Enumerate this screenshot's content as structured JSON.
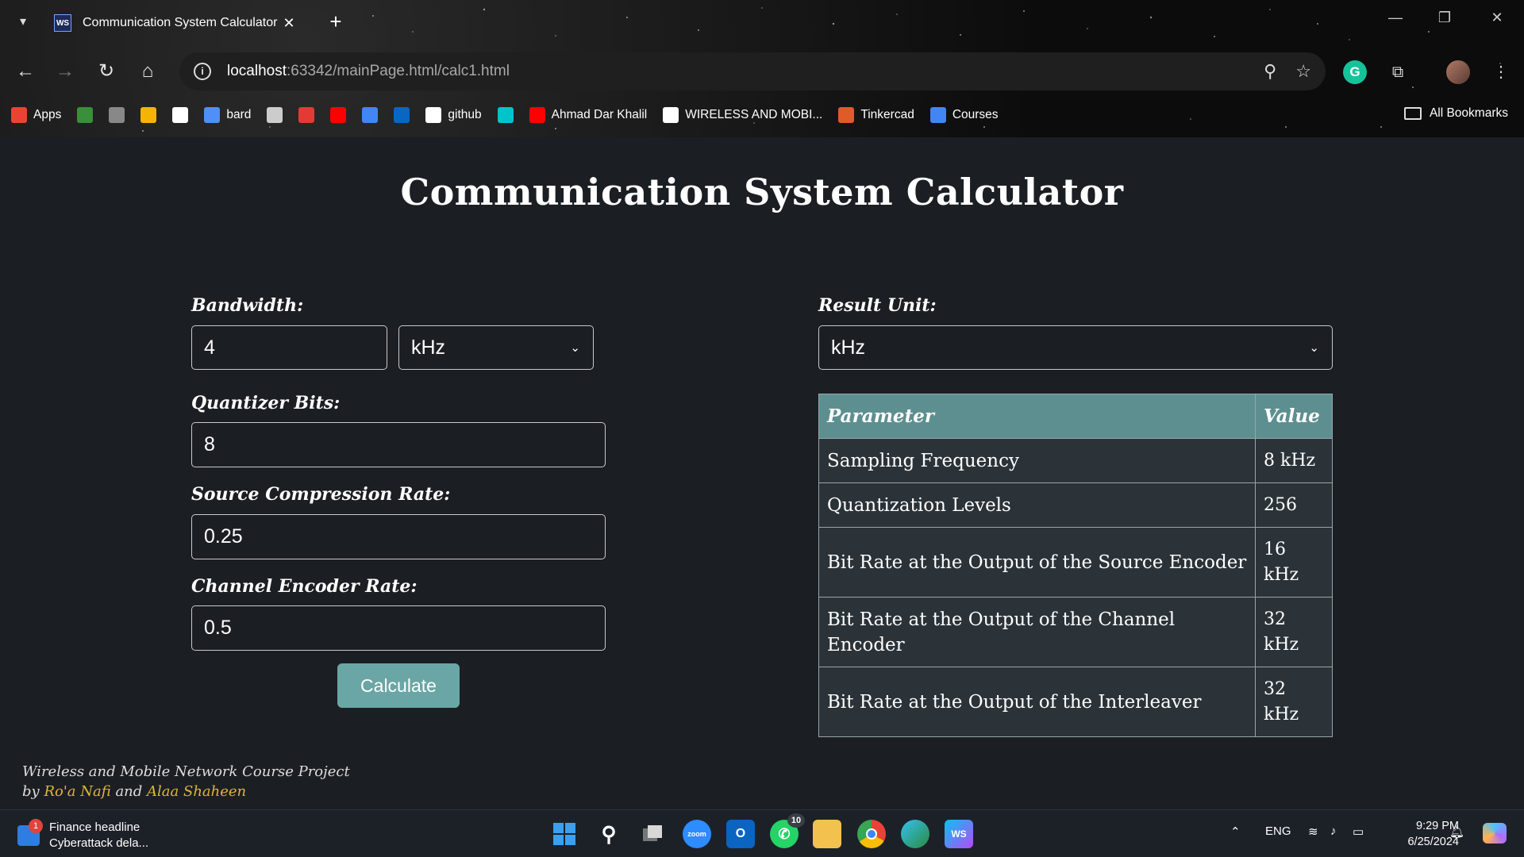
{
  "browser": {
    "tab_title": "Communication System Calculator",
    "tab_favicon": "WS",
    "url_host": "localhost",
    "url_rest": ":63342/mainPage.html/calc1.html",
    "bookmarks": [
      {
        "label": "Apps",
        "icon": "apps-grid-icon",
        "color": "#ea4335"
      },
      {
        "label": "",
        "icon": "leaf-icon",
        "color": "#3a8f3a"
      },
      {
        "label": "",
        "icon": "document-icon",
        "color": "#888888"
      },
      {
        "label": "",
        "icon": "google-drive-icon",
        "color": "#f4b400"
      },
      {
        "label": "",
        "icon": "chatgpt-icon",
        "color": "#ffffff"
      },
      {
        "label": "bard",
        "icon": "bard-sparkle-icon",
        "color": "#4f8ff7"
      },
      {
        "label": "",
        "icon": "seal-icon",
        "color": "#cccccc"
      },
      {
        "label": "",
        "icon": "lib-icon",
        "color": "#e53935"
      },
      {
        "label": "",
        "icon": "youtube-icon",
        "color": "#ff0000"
      },
      {
        "label": "",
        "icon": "google-translate-icon",
        "color": "#4285f4"
      },
      {
        "label": "",
        "icon": "linkedin-icon",
        "color": "#0a66c2"
      },
      {
        "label": "github",
        "icon": "github-icon",
        "color": "#ffffff"
      },
      {
        "label": "",
        "icon": "canva-icon",
        "color": "#00c4cc"
      },
      {
        "label": "Ahmad Dar Khalil",
        "icon": "youtube-icon",
        "color": "#ff0000"
      },
      {
        "label": "WIRELESS AND MOBI...",
        "icon": "notion-icon",
        "color": "#ffffff"
      },
      {
        "label": "Tinkercad",
        "icon": "tinkercad-icon",
        "color": "#e05a2a"
      },
      {
        "label": "Courses",
        "icon": "google-icon",
        "color": "#4285f4"
      }
    ],
    "all_bookmarks": "All Bookmarks"
  },
  "page": {
    "title": "Communication System Calculator",
    "bandwidth": {
      "label": "Bandwidth:",
      "value": "4",
      "unit": "kHz"
    },
    "quantizer": {
      "label": "Quantizer Bits:",
      "value": "8"
    },
    "compression": {
      "label": "Source Compression Rate:",
      "value": "0.25"
    },
    "channel": {
      "label": "Channel Encoder Rate:",
      "value": "0.5"
    },
    "calculate_label": "Calculate",
    "result_unit": {
      "label": "Result Unit:",
      "value": "kHz"
    },
    "table": {
      "headers": [
        "Parameter",
        "Value"
      ],
      "rows": [
        {
          "param": "Sampling Frequency",
          "value": "8 kHz"
        },
        {
          "param": "Quantization Levels",
          "value": "256"
        },
        {
          "param": "Bit Rate at the Output of the Source Encoder",
          "value": "16 kHz"
        },
        {
          "param": "Bit Rate at the Output of the Channel Encoder",
          "value": "32 kHz"
        },
        {
          "param": "Bit Rate at the Output of the Interleaver",
          "value": "32 kHz"
        }
      ]
    },
    "footer": {
      "line1": "Wireless and Mobile Network Course Project",
      "by": "by",
      "author1": "Ro'a Nafi",
      "and": "and",
      "author2": "Alaa Shaheen"
    }
  },
  "taskbar": {
    "widget_title": "Finance headline",
    "widget_subtitle": "Cyberattack dela...",
    "widget_badge": "1",
    "whatsapp_badge": "10",
    "language": "ENG",
    "time": "9:29 PM",
    "date": "6/25/2024"
  }
}
